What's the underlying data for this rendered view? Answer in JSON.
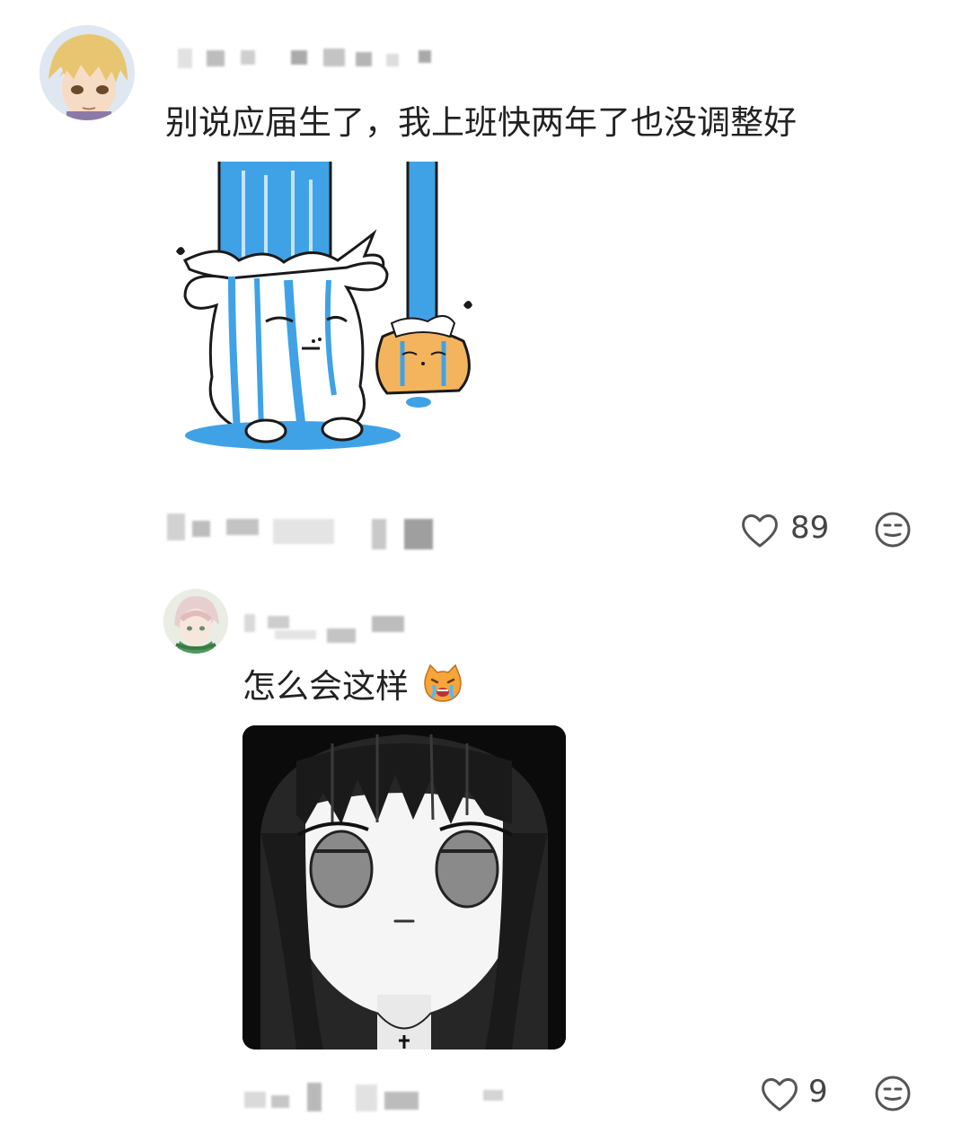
{
  "comments": [
    {
      "text": "别说应届生了，我上班快两年了也没调整好",
      "likes": "89",
      "avatar": "avatar-blonde-anime",
      "sticker": "waterfall-crying-sticker",
      "reply_icon": "neutral-face-icon"
    },
    {
      "text": "怎么会这样",
      "emoji": "crying-cat-emoji",
      "likes": "9",
      "avatar": "avatar-pink-hair-anime",
      "sticker": "sad-black-hair-girl-sticker",
      "reply_icon": "neutral-face-icon"
    }
  ],
  "colors": {
    "water_blue": "#3fa2e6",
    "icon_gray": "#555555",
    "text": "#222222"
  }
}
